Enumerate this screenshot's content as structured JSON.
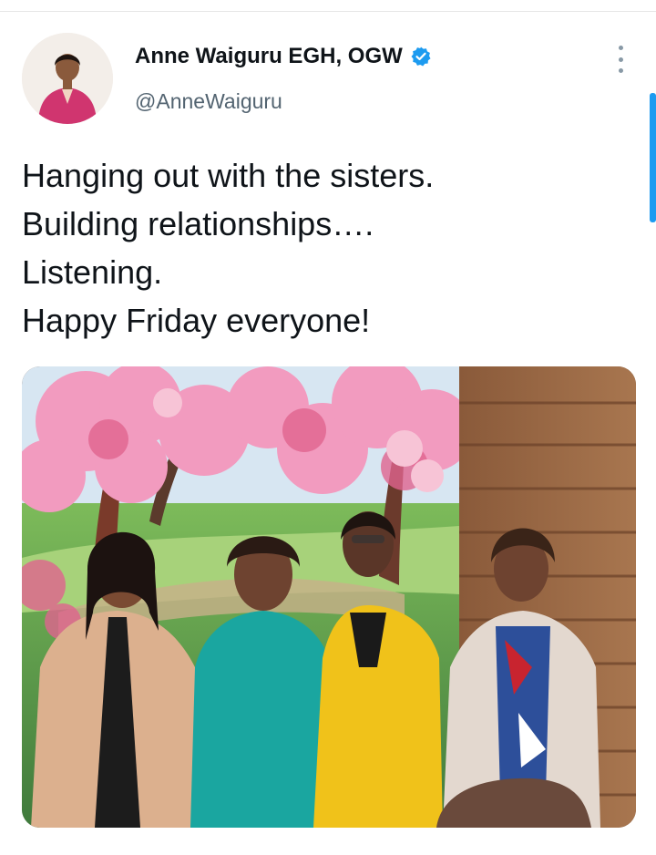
{
  "tweet": {
    "author": {
      "display_name": "Anne Waiguru EGH, OGW",
      "handle": "@AnneWaiguru",
      "verified": true,
      "avatar_icon": "profile-photo"
    },
    "text_lines": [
      "Hanging out with the sisters.",
      "Building relationships….",
      "Listening.",
      "Happy Friday everyone!"
    ],
    "media": {
      "type": "photo",
      "alt": ""
    }
  },
  "ui": {
    "more_icon": "more-vertical-icon",
    "verified_icon": "verified-badge-icon",
    "accent": "#1d9bf0",
    "text_color": "#0f1419",
    "muted": "#536471"
  }
}
